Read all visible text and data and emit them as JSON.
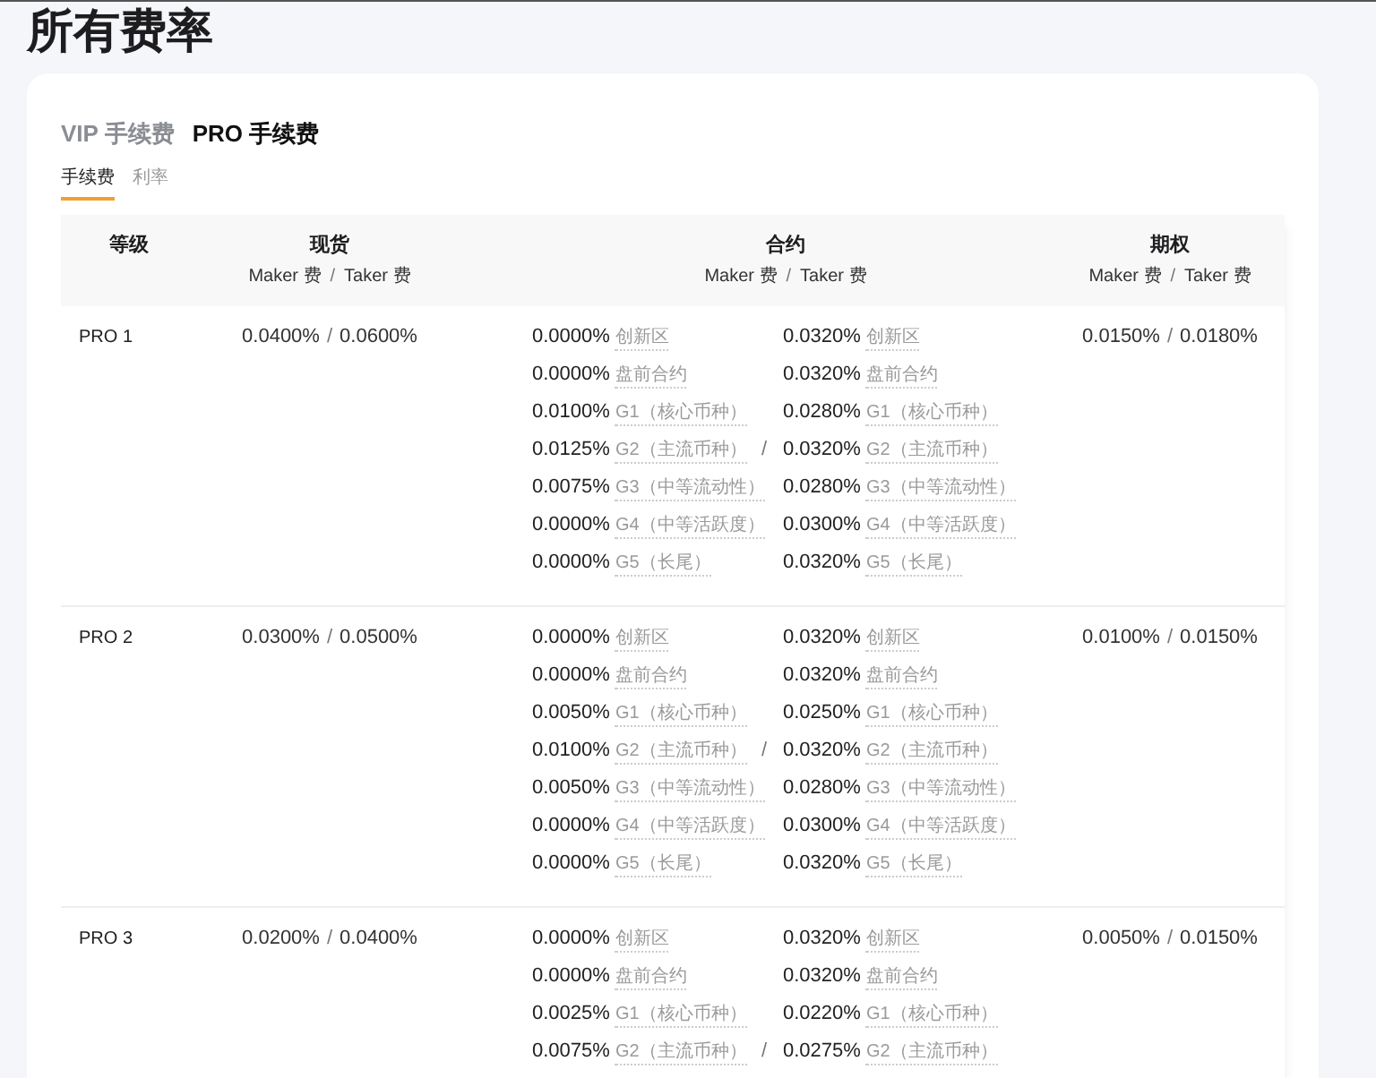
{
  "page_title": "所有费率",
  "fee_tabs": [
    {
      "label": "VIP 手续费",
      "selected": false
    },
    {
      "label": "PRO 手续费",
      "selected": true
    }
  ],
  "sub_tabs": [
    {
      "label": "手续费",
      "selected": true
    },
    {
      "label": "利率",
      "selected": false
    }
  ],
  "table": {
    "columns": [
      {
        "title": "等级"
      },
      {
        "title": "现货",
        "maker": "Maker 费",
        "separator": "/",
        "taker": "Taker 费"
      },
      {
        "title": "合约",
        "maker": "Maker 费",
        "separator": "/",
        "taker": "Taker 费"
      },
      {
        "title": "期权",
        "maker": "Maker 费",
        "separator": "/",
        "taker": "Taker 费"
      }
    ],
    "rows": [
      {
        "level": "PRO 1",
        "spot": {
          "maker": "0.0400%",
          "separator": "/",
          "taker": "0.0600%"
        },
        "futures": [
          {
            "maker": "0.0000%",
            "maker_tier": "创新区",
            "taker": "0.0320%",
            "taker_tier": "创新区"
          },
          {
            "maker": "0.0000%",
            "maker_tier": "盘前合约",
            "taker": "0.0320%",
            "taker_tier": "盘前合约"
          },
          {
            "maker": "0.0100%",
            "maker_tier": "G1（核心币种）",
            "taker": "0.0280%",
            "taker_tier": "G1（核心币种）"
          },
          {
            "maker": "0.0125%",
            "maker_tier": "G2（主流币种）",
            "separator": "/",
            "taker": "0.0320%",
            "taker_tier": "G2（主流币种）"
          },
          {
            "maker": "0.0075%",
            "maker_tier": "G3（中等流动性）",
            "taker": "0.0280%",
            "taker_tier": "G3（中等流动性）"
          },
          {
            "maker": "0.0000%",
            "maker_tier": "G4（中等活跃度）",
            "taker": "0.0300%",
            "taker_tier": "G4（中等活跃度）"
          },
          {
            "maker": "0.0000%",
            "maker_tier": "G5（长尾）",
            "taker": "0.0320%",
            "taker_tier": "G5（长尾）"
          }
        ],
        "options": {
          "maker": "0.0150%",
          "separator": "/",
          "taker": "0.0180%"
        }
      },
      {
        "level": "PRO 2",
        "spot": {
          "maker": "0.0300%",
          "separator": "/",
          "taker": "0.0500%"
        },
        "futures": [
          {
            "maker": "0.0000%",
            "maker_tier": "创新区",
            "taker": "0.0320%",
            "taker_tier": "创新区"
          },
          {
            "maker": "0.0000%",
            "maker_tier": "盘前合约",
            "taker": "0.0320%",
            "taker_tier": "盘前合约"
          },
          {
            "maker": "0.0050%",
            "maker_tier": "G1（核心币种）",
            "taker": "0.0250%",
            "taker_tier": "G1（核心币种）"
          },
          {
            "maker": "0.0100%",
            "maker_tier": "G2（主流币种）",
            "separator": "/",
            "taker": "0.0320%",
            "taker_tier": "G2（主流币种）"
          },
          {
            "maker": "0.0050%",
            "maker_tier": "G3（中等流动性）",
            "taker": "0.0280%",
            "taker_tier": "G3（中等流动性）"
          },
          {
            "maker": "0.0000%",
            "maker_tier": "G4（中等活跃度）",
            "taker": "0.0300%",
            "taker_tier": "G4（中等活跃度）"
          },
          {
            "maker": "0.0000%",
            "maker_tier": "G5（长尾）",
            "taker": "0.0320%",
            "taker_tier": "G5（长尾）"
          }
        ],
        "options": {
          "maker": "0.0100%",
          "separator": "/",
          "taker": "0.0150%"
        }
      },
      {
        "level": "PRO 3",
        "spot": {
          "maker": "0.0200%",
          "separator": "/",
          "taker": "0.0400%"
        },
        "futures": [
          {
            "maker": "0.0000%",
            "maker_tier": "创新区",
            "taker": "0.0320%",
            "taker_tier": "创新区"
          },
          {
            "maker": "0.0000%",
            "maker_tier": "盘前合约",
            "taker": "0.0320%",
            "taker_tier": "盘前合约"
          },
          {
            "maker": "0.0025%",
            "maker_tier": "G1（核心币种）",
            "taker": "0.0220%",
            "taker_tier": "G1（核心币种）"
          },
          {
            "maker": "0.0075%",
            "maker_tier": "G2（主流币种）",
            "separator": "/",
            "taker": "0.0275%",
            "taker_tier": "G2（主流币种）"
          }
        ],
        "options": {
          "maker": "0.0050%",
          "separator": "/",
          "taker": "0.0150%"
        }
      }
    ]
  }
}
